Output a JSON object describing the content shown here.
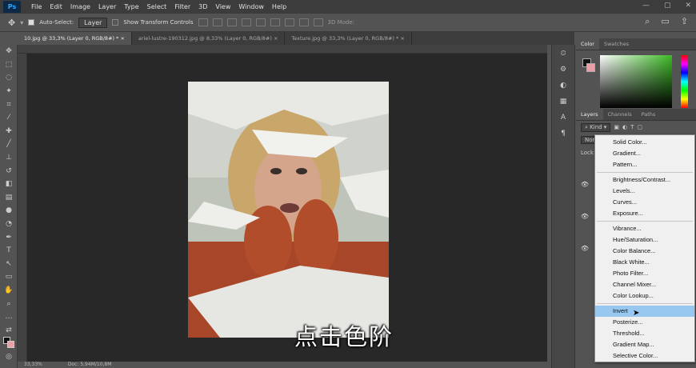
{
  "app": {
    "logo": "Ps",
    "window_controls": [
      "—",
      "▢",
      "✕"
    ]
  },
  "menu": [
    "File",
    "Edit",
    "Image",
    "Layer",
    "Type",
    "Select",
    "Filter",
    "3D",
    "View",
    "Window",
    "Help"
  ],
  "options_bar": {
    "auto_select_label": "Auto-Select:",
    "auto_select_value": "Layer",
    "transform_label": "Show Transform Controls",
    "mode_label": "3D Mode:"
  },
  "tabs": [
    {
      "label": "10.jpg @ 33,3% (Layer 0, RGB/8#) *",
      "close": "×"
    },
    {
      "label": "ariel-lustre-190312.jpg @ 8,33% (Layer 0, RGB/8#)",
      "close": "×"
    },
    {
      "label": "Texture.jpg @ 33,3% (Layer 0, RGB/8#) *",
      "close": "×"
    }
  ],
  "status": {
    "zoom": "33,33%",
    "doc": "Doc: 5,94M/10,8M"
  },
  "subtitle": "点击色阶",
  "panel": {
    "color_tabs": [
      "Color",
      "Swatches"
    ],
    "layers_tabs": [
      "Layers",
      "Channels",
      "Paths"
    ],
    "kind_label": "Kind",
    "blend_mode": "Norm",
    "lock_label": "Lock:"
  },
  "dropdown": {
    "groups": [
      [
        "Solid Color...",
        "Gradient...",
        "Pattern..."
      ],
      [
        "Brightness/Contrast...",
        "Levels...",
        "Curves...",
        "Exposure..."
      ],
      [
        "Vibrance...",
        "Hue/Saturation...",
        "Color Balance...",
        "Black  White...",
        "Photo Filter...",
        "Channel Mixer...",
        "Color Lookup..."
      ],
      [
        "Invert",
        "Posterize...",
        "Threshold...",
        "Gradient Map...",
        "Selective Color..."
      ]
    ],
    "highlighted": "Invert"
  },
  "colors": {
    "fg": "#111111",
    "bg": "#e9a0a6",
    "accent": "#98c7f0"
  }
}
